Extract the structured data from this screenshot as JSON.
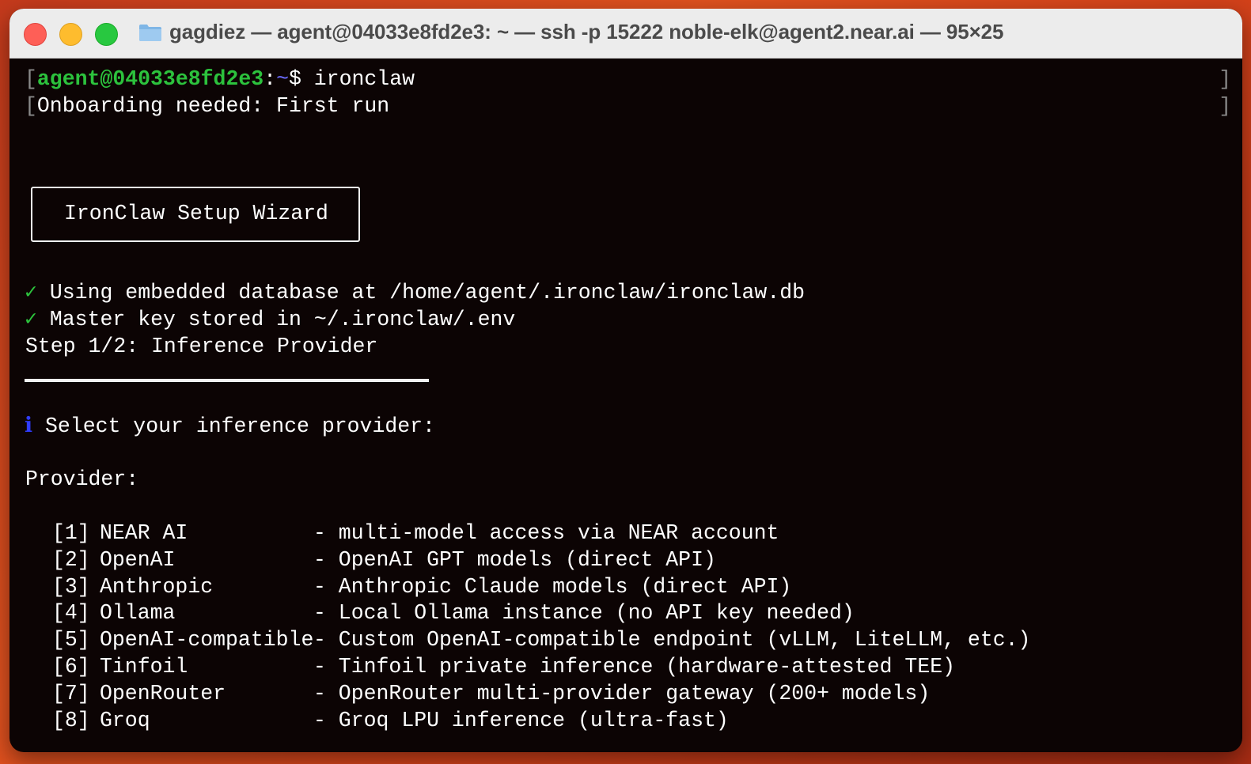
{
  "window": {
    "title": "gagdiez — agent@04033e8fd2e3: ~ — ssh -p 15222 noble-elk@agent2.near.ai — 95×25"
  },
  "terminal": {
    "prompt_user": "agent@04033e8fd2e3",
    "prompt_sep": ":",
    "prompt_path": "~",
    "prompt_symbol": "$ ",
    "command": "ironclaw",
    "onboarding": "Onboarding needed: First run",
    "wizard_title": "IronClaw Setup Wizard",
    "check_db": "Using embedded database at /home/agent/.ironclaw/ironclaw.db",
    "check_key": "Master key stored in ~/.ironclaw/.env",
    "step": "Step 1/2: Inference Provider",
    "select_prompt": "Select your inference provider:",
    "provider_heading": "Provider:",
    "check_glyph": "✓",
    "info_glyph": "ℹ",
    "providers": [
      {
        "index": "[1]",
        "name": "NEAR AI",
        "desc": "- multi-model access via NEAR account"
      },
      {
        "index": "[2]",
        "name": "OpenAI",
        "desc": "- OpenAI GPT models (direct API)"
      },
      {
        "index": "[3]",
        "name": "Anthropic",
        "desc": "- Anthropic Claude models (direct API)"
      },
      {
        "index": "[4]",
        "name": "Ollama",
        "desc": "- Local Ollama instance (no API key needed)"
      },
      {
        "index": "[5]",
        "name": "OpenAI-compatible",
        "desc": "- Custom OpenAI-compatible endpoint (vLLM, LiteLLM, etc.)"
      },
      {
        "index": "[6]",
        "name": "Tinfoil",
        "desc": "- Tinfoil private inference (hardware-attested TEE)"
      },
      {
        "index": "[7]",
        "name": "OpenRouter",
        "desc": "- OpenRouter multi-provider gateway (200+ models)"
      },
      {
        "index": "[8]",
        "name": "Groq",
        "desc": "- Groq LPU inference (ultra-fast)"
      }
    ]
  },
  "colors": {
    "prompt_user": "#2cc23d",
    "prompt_path": "#6b6bff",
    "check": "#2cc23d",
    "info": "#2f3cff",
    "terminal_bg": "#0c0404"
  }
}
